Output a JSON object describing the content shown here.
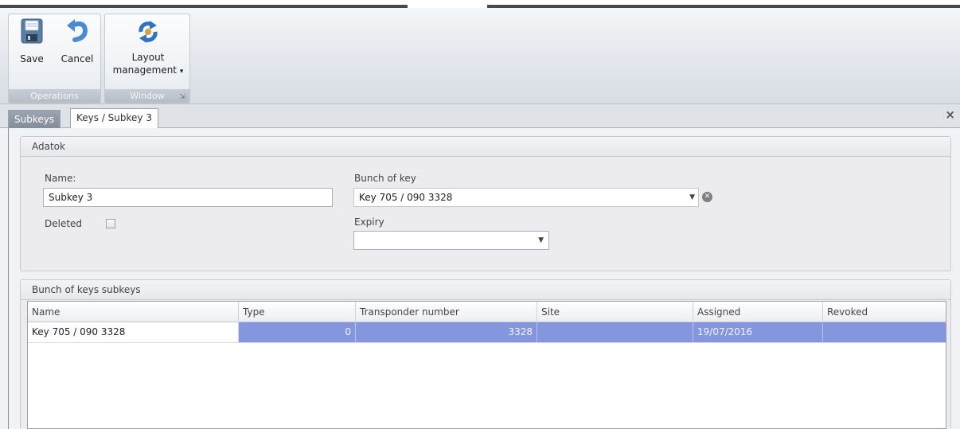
{
  "ribbon": {
    "groups": [
      {
        "caption": "Operations",
        "buttons": [
          {
            "label": "Save",
            "icon": "floppy-disk-icon"
          },
          {
            "label": "Cancel",
            "icon": "undo-arrow-icon"
          }
        ]
      },
      {
        "caption": "Window",
        "buttons": [
          {
            "label_line1": "Layout",
            "label_line2": "management",
            "dropdown": "▾",
            "icon": "circular-arrows-icon"
          }
        ],
        "launcher": "⇲"
      }
    ]
  },
  "tabs": [
    {
      "label": "Subkeys",
      "active": false
    },
    {
      "label": "Keys / Subkey 3",
      "active": true
    }
  ],
  "close_glyph": "×",
  "adatok": {
    "title": "Adatok",
    "name_label": "Name:",
    "name_value": "Subkey 3",
    "deleted_label": "Deleted",
    "deleted_checked": false,
    "bunch_label": "Bunch of key",
    "bunch_value": "Key 705 / 090 3328",
    "expiry_label": "Expiry",
    "expiry_value": ""
  },
  "subkeys": {
    "title": "Bunch of keys subkeys",
    "columns": [
      "Name",
      "Type",
      "Transponder number",
      "Site",
      "Assigned",
      "Revoked"
    ],
    "rows": [
      {
        "name": "Key 705 / 090 3328",
        "type": "0",
        "transponder": "3328",
        "site": "",
        "assigned": "19/07/2016",
        "revoked": ""
      }
    ]
  },
  "colors": {
    "selection": "#8496dd",
    "ribbon_caption": "#b4bcc6"
  }
}
